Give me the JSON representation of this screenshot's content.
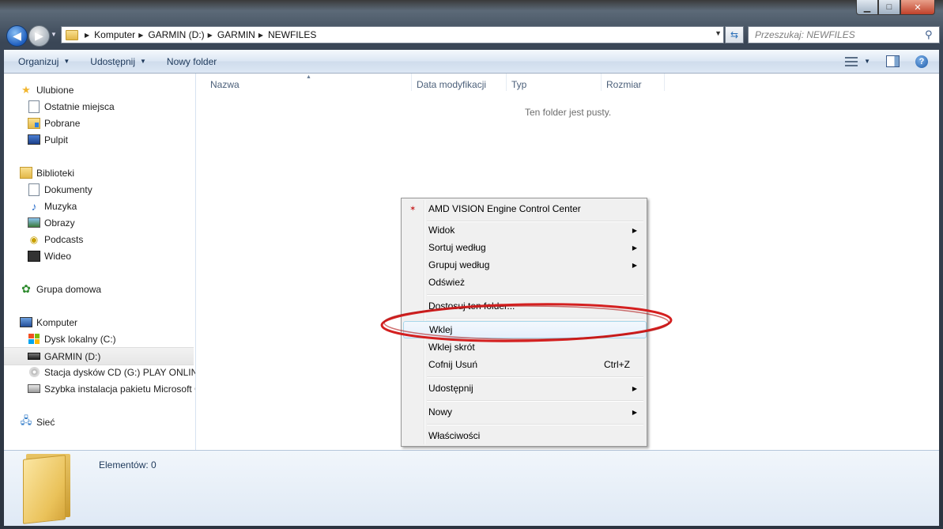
{
  "window": {
    "caption_buttons": {
      "minimize": "▁",
      "maximize": "□",
      "close": "✕"
    }
  },
  "address": {
    "breadcrumbs": [
      "Komputer",
      "GARMIN (D:)",
      "GARMIN",
      "NEWFILES"
    ],
    "search_placeholder": "Przeszukaj: NEWFILES"
  },
  "toolbar": {
    "organize": "Organizuj",
    "share": "Udostępnij",
    "new_folder": "Nowy folder"
  },
  "nav": {
    "favorites_header": "Ulubione",
    "favorites": [
      "Ostatnie miejsca",
      "Pobrane",
      "Pulpit"
    ],
    "libraries_header": "Biblioteki",
    "libraries": [
      "Dokumenty",
      "Muzyka",
      "Obrazy",
      "Podcasts",
      "Wideo"
    ],
    "homegroup": "Grupa domowa",
    "computer_header": "Komputer",
    "drives": [
      "Dysk lokalny (C:)",
      "GARMIN (D:)",
      "Stacja dysków CD (G:) PLAY ONLINE",
      "Szybka instalacja pakietu Microsoft Office"
    ],
    "network": "Sieć"
  },
  "content": {
    "columns": [
      "Nazwa",
      "Data modyfikacji",
      "Typ",
      "Rozmiar"
    ],
    "empty_message": "Ten folder jest pusty."
  },
  "details": {
    "count": "Elementów: 0"
  },
  "context_menu": {
    "amd": "AMD VISION Engine Control Center",
    "view": "Widok",
    "sort_by": "Sortuj według",
    "group_by": "Grupuj według",
    "refresh": "Odśwież",
    "customize": "Dostosuj ten folder...",
    "paste": "Wklej",
    "paste_shortcut": "Wklej skrót",
    "undo": "Cofnij Usuń",
    "undo_shortcut": "Ctrl+Z",
    "share": "Udostępnij",
    "new": "Nowy",
    "properties": "Właściwości"
  },
  "colors": {
    "annotation_ellipse": "#d42020",
    "highlight_border": "#a8d8eb"
  }
}
